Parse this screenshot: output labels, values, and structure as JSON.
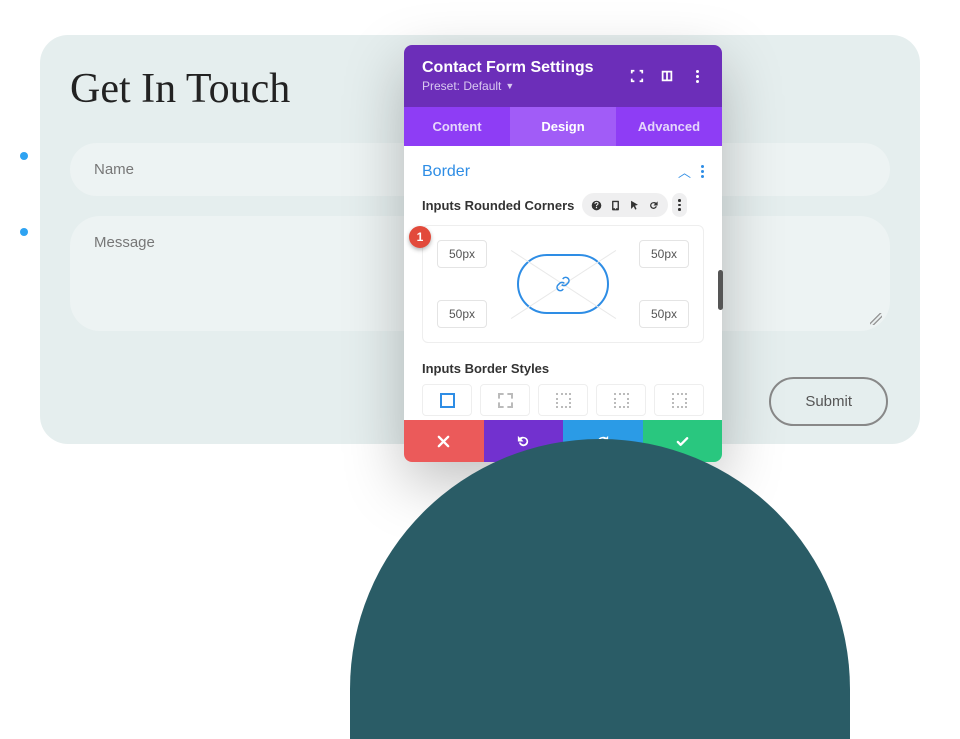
{
  "page": {
    "heading": "Get In Touch",
    "name_placeholder": "Name",
    "message_placeholder": "Message",
    "submit_label": "Submit"
  },
  "modal": {
    "title": "Contact Form Settings",
    "preset_label": "Preset: Default",
    "tabs": {
      "content": "Content",
      "design": "Design",
      "advanced": "Advanced"
    },
    "section": {
      "title": "Border",
      "option_label": "Inputs Rounded Corners",
      "corners": {
        "tl": "50px",
        "tr": "50px",
        "bl": "50px",
        "br": "50px"
      },
      "styles_label": "Inputs Border Styles"
    },
    "marker": "1"
  }
}
